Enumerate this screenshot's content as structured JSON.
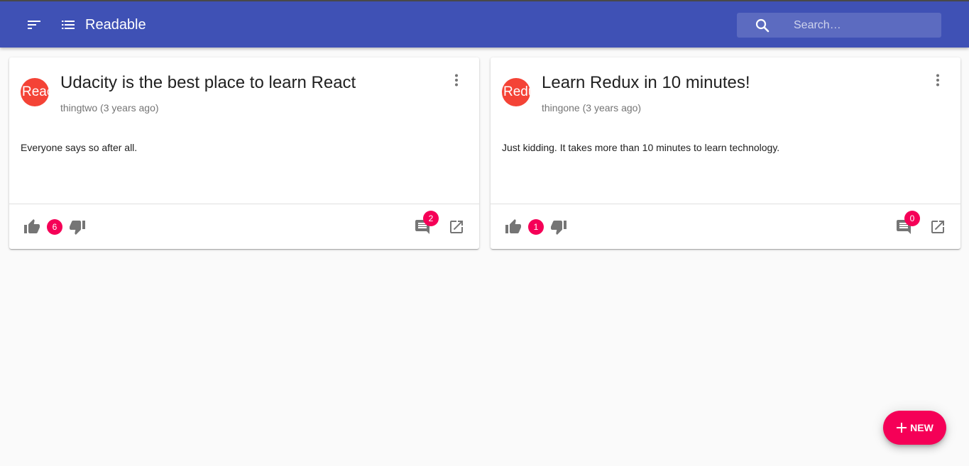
{
  "app": {
    "title": "Readable",
    "sort_icon": "sort-icon",
    "list_icon": "list-icon"
  },
  "search": {
    "placeholder": "Search…",
    "value": "",
    "icon": "search-icon"
  },
  "posts": [
    {
      "avatar": "React",
      "title": "Udacity is the best place to learn React",
      "subheader": "thingtwo (3 years ago)",
      "body": "Everyone says so after all.",
      "score": "6",
      "comment_count": "2"
    },
    {
      "avatar": "Redux",
      "title": "Learn Redux in 10 minutes!",
      "subheader": "thingone (3 years ago)",
      "body": "Just kidding. It takes more than 10 minutes to learn technology.",
      "score": "1",
      "comment_count": "0"
    }
  ],
  "fab": {
    "label": "NEW",
    "icon": "plus-icon"
  },
  "colors": {
    "primary": "#3f51b5",
    "search_bg": "#5c6bc0",
    "accent": "#f50057",
    "avatar": "#f44336",
    "background": "#fafafa"
  }
}
